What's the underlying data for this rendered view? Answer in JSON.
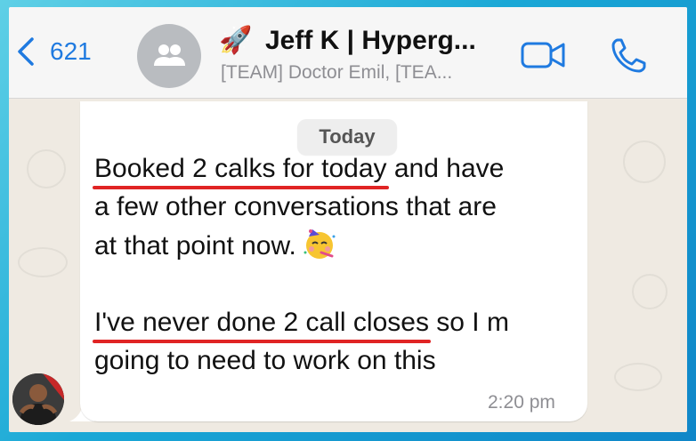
{
  "header": {
    "back_count": "621",
    "title_emoji": "🚀",
    "title": "Jeff K | Hyperg...",
    "subtitle": "[TEAM] Doctor Emil, [TEA..."
  },
  "chat": {
    "date_label": "Today",
    "message": {
      "line1_highlight": "Booked 2 calks for today",
      "line1_rest": " and have",
      "line2": "a few other conversations that are",
      "line3": "at that point now.",
      "emoji": "🥳",
      "line4_highlight": "I've never done 2 call closes",
      "line4_rest": " so I m",
      "line5": "going to need to work on this"
    },
    "time": "2:20 pm"
  },
  "icons": {
    "back": "chevron-left-icon",
    "group_avatar": "group-icon",
    "video": "video-camera-icon",
    "phone": "phone-icon"
  },
  "colors": {
    "accent": "#1f7ae0",
    "highlight_underline": "#e02424",
    "chat_background": "#efeae2",
    "frame_border": "#1aa8d6"
  }
}
